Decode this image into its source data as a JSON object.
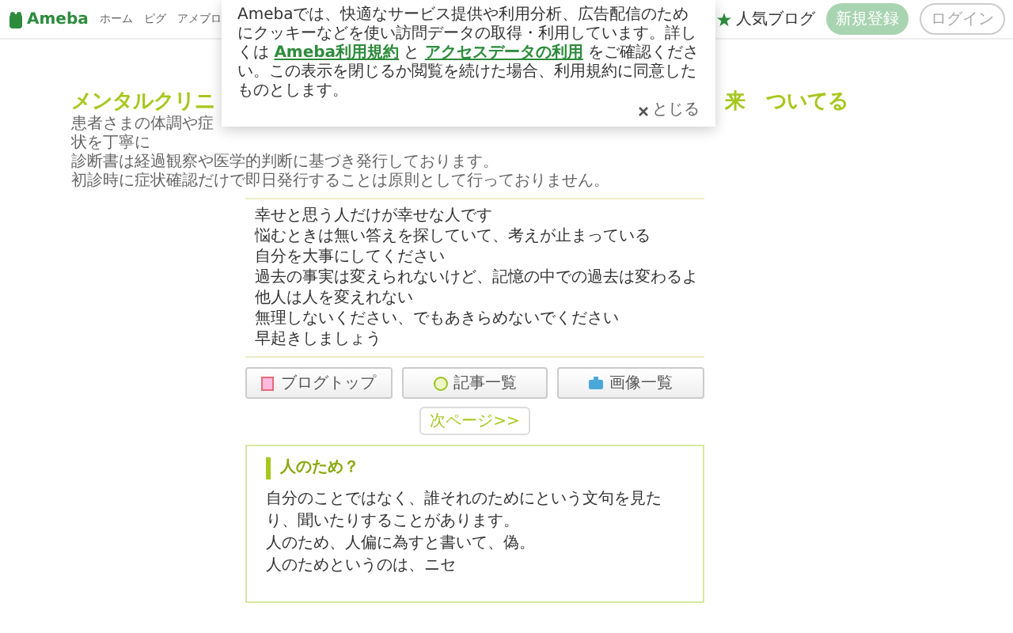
{
  "header": {
    "logo": "Ameba",
    "nav": [
      "ホーム",
      "ピグ",
      "アメブロ"
    ],
    "popular": "人気ブログ",
    "signup": "新規登録",
    "login": "ログイン"
  },
  "cookie_notice": {
    "segments": [
      {
        "kind": "text",
        "text": "Amebaでは、快適なサービス提供や利用分析、広告配信のためにクッキーなどを使い訪問データの取得・利用しています。詳しくは "
      },
      {
        "kind": "link",
        "text": "Ameba利用規約"
      },
      {
        "kind": "text",
        "text": " と "
      },
      {
        "kind": "link",
        "text": "アクセスデータの利用"
      },
      {
        "kind": "text",
        "text": " をご確認ください。この表示を閉じるか閲覧を続けた場合、利用規約に同意したものとします。"
      }
    ],
    "close": "とじる"
  },
  "blog": {
    "title_start": "メンタルクリニ",
    "title_end": "来　ついてる",
    "description": [
      "患者さまの体調や症状を丁寧に",
      "診断書は経過観察や医学的判断に基づき発行しております。",
      "初診時に症状確認だけで即日発行することは原則として行っておりません。"
    ],
    "quotes": [
      "幸せと思う人だけが幸せな人です",
      "悩むときは無い答えを探していて、考えが止まっている",
      "自分を大事にしてください",
      "過去の事実は変えられないけど、記憶の中での過去は変わるよ",
      "他人は人を変えれない",
      "無理しないください、でもあきらめないでください",
      "早起きしましょう"
    ],
    "nav_buttons": [
      {
        "kind": "top",
        "label": "ブログトップ"
      },
      {
        "kind": "entries",
        "label": "記事一覧"
      },
      {
        "kind": "images",
        "label": "画像一覧"
      }
    ],
    "next_page": "次ページ>>"
  },
  "entry": {
    "title": "人のため？",
    "paragraphs": [
      "自分のことではなく、誰それのためにという文句を見たり、聞いたりすることがあります。",
      "人のため、人偏に為すと書いて、偽。",
      "人のためというのは、ニセ"
    ]
  }
}
